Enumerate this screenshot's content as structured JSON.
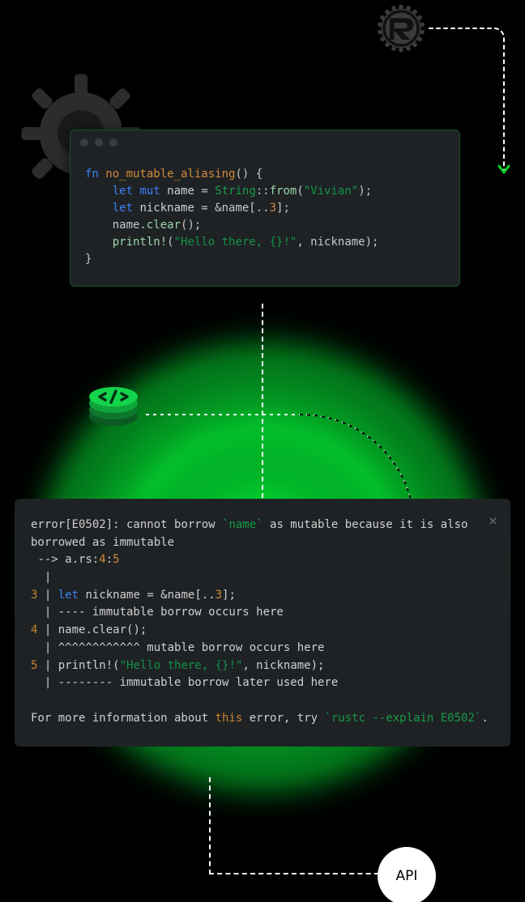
{
  "logos": {
    "rust": "rust-logo"
  },
  "code_window": {
    "tokens": [
      {
        "c": "kw",
        "t": "fn "
      },
      {
        "c": "fnname",
        "t": "no_mutable_aliasing"
      },
      {
        "c": "op",
        "t": "() {\n"
      },
      {
        "c": "op",
        "t": "    "
      },
      {
        "c": "kw",
        "t": "let "
      },
      {
        "c": "kw",
        "t": "mut "
      },
      {
        "c": "txt",
        "t": "name "
      },
      {
        "c": "op",
        "t": "= "
      },
      {
        "c": "type",
        "t": "String"
      },
      {
        "c": "op",
        "t": "::"
      },
      {
        "c": "call",
        "t": "from"
      },
      {
        "c": "op",
        "t": "("
      },
      {
        "c": "str",
        "t": "\"Vivian\""
      },
      {
        "c": "op",
        "t": ");\n"
      },
      {
        "c": "op",
        "t": "    "
      },
      {
        "c": "kw",
        "t": "let "
      },
      {
        "c": "txt",
        "t": "nickname "
      },
      {
        "c": "op",
        "t": "= &name[.."
      },
      {
        "c": "num",
        "t": "3"
      },
      {
        "c": "op",
        "t": "];\n"
      },
      {
        "c": "op",
        "t": "    name."
      },
      {
        "c": "call",
        "t": "clear"
      },
      {
        "c": "op",
        "t": "();\n"
      },
      {
        "c": "op",
        "t": "    "
      },
      {
        "c": "call",
        "t": "println!"
      },
      {
        "c": "op",
        "t": "("
      },
      {
        "c": "str",
        "t": "\"Hello there, {}!\""
      },
      {
        "c": "op",
        "t": ", nickname);\n}"
      }
    ]
  },
  "error_panel": {
    "close_label": "×",
    "tokens": [
      {
        "c": "txt",
        "t": "error[E0502]: cannot borrow "
      },
      {
        "c": "hl-type",
        "t": "`name`"
      },
      {
        "c": "txt",
        "t": " as mutable because it is also borrowed as immutable\n --> a.rs:"
      },
      {
        "c": "num",
        "t": "4"
      },
      {
        "c": "txt",
        "t": ":"
      },
      {
        "c": "num",
        "t": "5"
      },
      {
        "c": "txt",
        "t": "\n  |\n"
      },
      {
        "c": "ln",
        "t": "3"
      },
      {
        "c": "txt",
        "t": " | "
      },
      {
        "c": "kw",
        "t": "let"
      },
      {
        "c": "txt",
        "t": " nickname = &name[.."
      },
      {
        "c": "num",
        "t": "3"
      },
      {
        "c": "txt",
        "t": "];\n  | ---- immutable borrow occurs here\n"
      },
      {
        "c": "ln",
        "t": "4"
      },
      {
        "c": "txt",
        "t": " | name.clear();\n  | ^^^^^^^^^^^^ mutable borrow occurs here\n"
      },
      {
        "c": "ln",
        "t": "5"
      },
      {
        "c": "txt",
        "t": " | println!("
      },
      {
        "c": "str",
        "t": "\"Hello there, {}!\""
      },
      {
        "c": "txt",
        "t": ", nickname);\n  | -------- immutable borrow later used here\n\nFor more information about "
      },
      {
        "c": "hl-this",
        "t": "this"
      },
      {
        "c": "txt",
        "t": " error, try "
      },
      {
        "c": "hl-type",
        "t": "`rustc --explain E0502`"
      },
      {
        "c": "txt",
        "t": "."
      }
    ]
  },
  "api_pill": {
    "label": "API"
  }
}
